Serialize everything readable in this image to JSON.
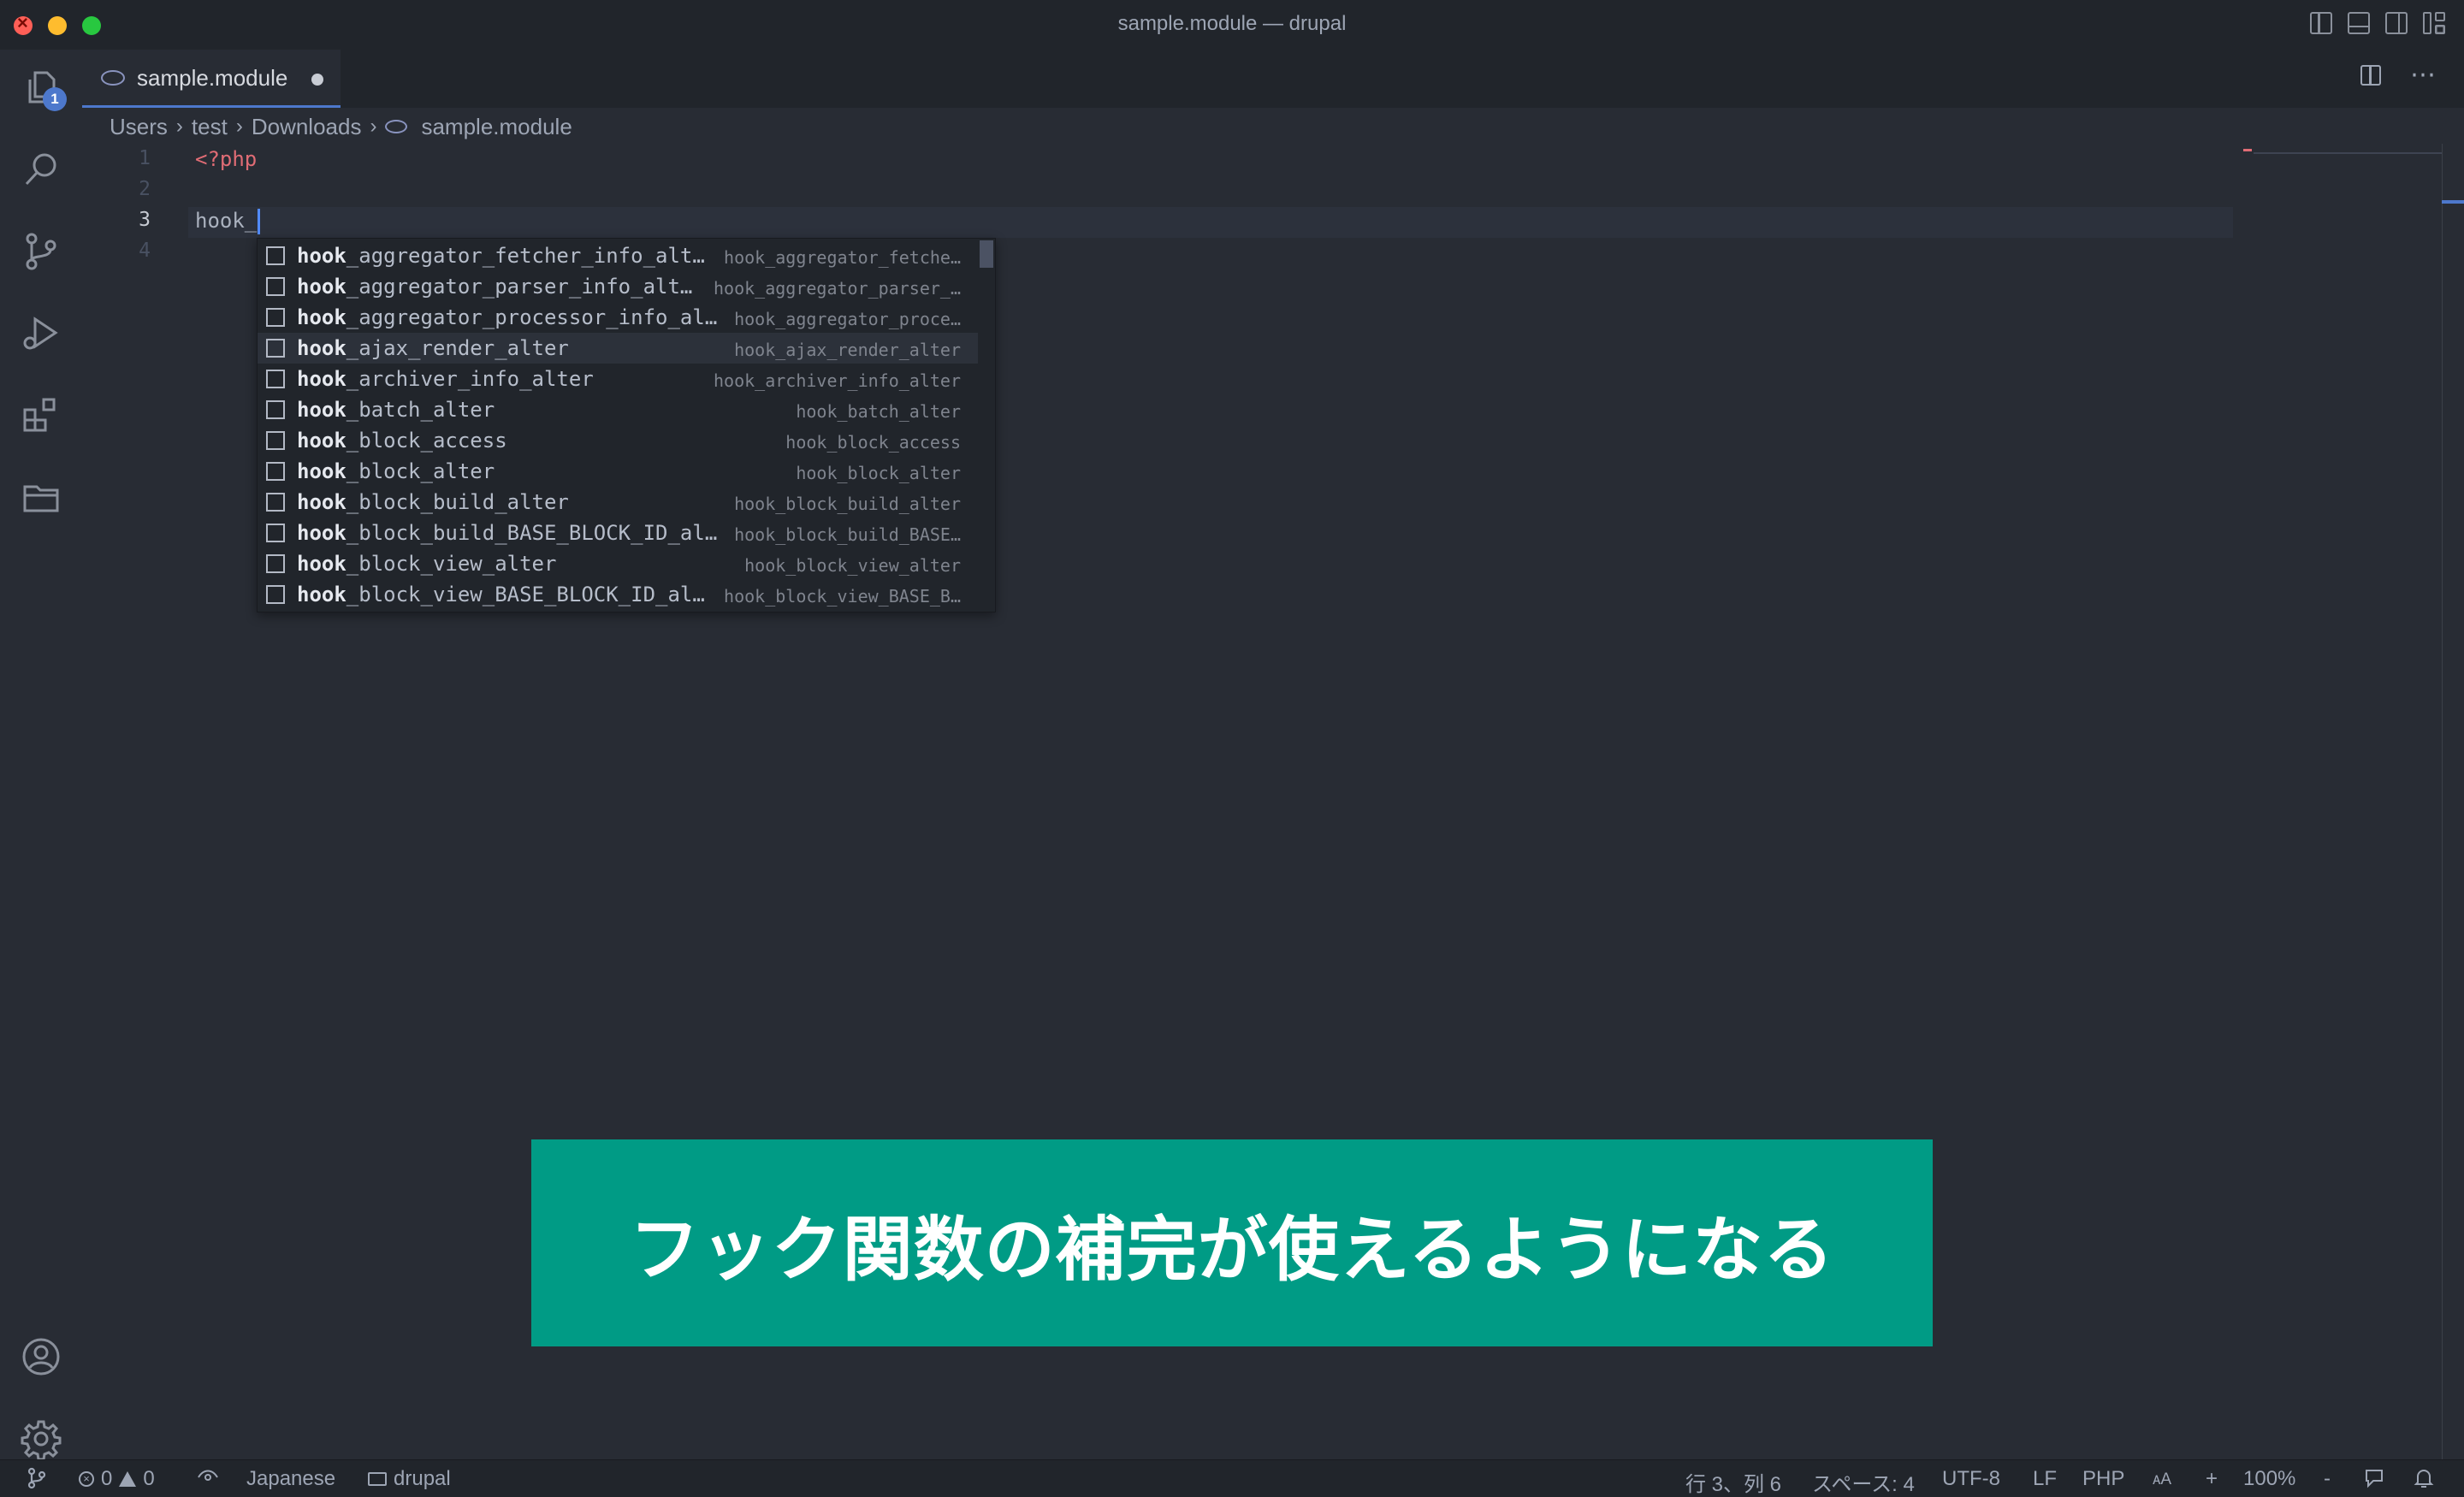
{
  "window": {
    "title": "sample.module — drupal"
  },
  "activity_bar": {
    "explorer_badge": "1"
  },
  "tabs": [
    {
      "label": "sample.module",
      "modified": true
    }
  ],
  "breadcrumb": [
    "Users",
    "test",
    "Downloads",
    "sample.module"
  ],
  "editor": {
    "line_numbers": [
      "1",
      "2",
      "3",
      "4"
    ],
    "lines": [
      "<?php",
      "",
      "hook_",
      ""
    ],
    "active_line": 3
  },
  "suggestions": {
    "match_prefix": "hook",
    "items": [
      {
        "prefix": "hook",
        "rest": "_aggregator_fetcher_info_alt…",
        "detail": "hook_aggregator_fetche…"
      },
      {
        "prefix": "hook",
        "rest": "_aggregator_parser_info_alt…",
        "detail": "hook_aggregator_parser_…"
      },
      {
        "prefix": "hook",
        "rest": "_aggregator_processor_info_al…",
        "detail": "hook_aggregator_proce…"
      },
      {
        "prefix": "hook",
        "rest": "_ajax_render_alter",
        "detail": "hook_ajax_render_alter"
      },
      {
        "prefix": "hook",
        "rest": "_archiver_info_alter",
        "detail": "hook_archiver_info_alter"
      },
      {
        "prefix": "hook",
        "rest": "_batch_alter",
        "detail": "hook_batch_alter"
      },
      {
        "prefix": "hook",
        "rest": "_block_access",
        "detail": "hook_block_access"
      },
      {
        "prefix": "hook",
        "rest": "_block_alter",
        "detail": "hook_block_alter"
      },
      {
        "prefix": "hook",
        "rest": "_block_build_alter",
        "detail": "hook_block_build_alter"
      },
      {
        "prefix": "hook",
        "rest": "_block_build_BASE_BLOCK_ID_al…",
        "detail": "hook_block_build_BASE…"
      },
      {
        "prefix": "hook",
        "rest": "_block_view_alter",
        "detail": "hook_block_view_alter"
      },
      {
        "prefix": "hook",
        "rest": "_block_view_BASE_BLOCK_ID_al…",
        "detail": "hook_block_view_BASE_B…"
      }
    ],
    "selected_index": 3
  },
  "caption": {
    "text": "フック関数の補完が使えるようになる",
    "background": "#009b85"
  },
  "status_bar": {
    "errors": "0",
    "warnings": "0",
    "keymap": "Japanese",
    "folder": "drupal",
    "position": "行 3、列 6",
    "indent": "スペース: 4",
    "encoding": "UTF-8",
    "eol": "LF",
    "language": "PHP",
    "font_size_toggle": "ᴀA",
    "zoom_in": "+",
    "zoom": "100%",
    "zoom_out": "-"
  },
  "colors": {
    "accent": "#4d78cc",
    "php_tag": "#e06c75",
    "editor_bg": "#282c34"
  }
}
